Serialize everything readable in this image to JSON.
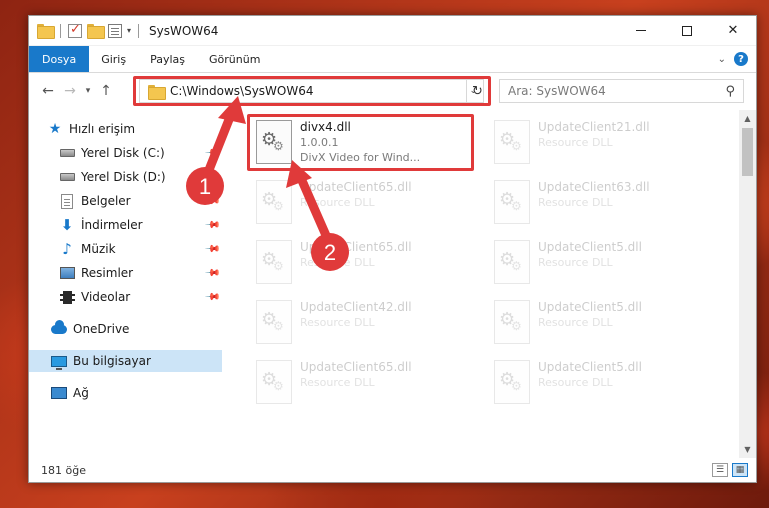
{
  "window": {
    "title": "SysWOW64"
  },
  "ribbon": {
    "tabs": [
      "Dosya",
      "Giriş",
      "Paylaş",
      "Görünüm"
    ]
  },
  "nav": {
    "address": "C:\\Windows\\SysWOW64",
    "search_placeholder": "Ara: SysWOW64"
  },
  "sidebar": {
    "items": [
      {
        "label": "Hızlı erişim",
        "icon": "star-icon"
      },
      {
        "label": "Yerel Disk (C:)",
        "icon": "disk-icon"
      },
      {
        "label": "Yerel Disk (D:)",
        "icon": "disk-icon"
      },
      {
        "label": "Belgeler",
        "icon": "documents-icon"
      },
      {
        "label": "İndirmeler",
        "icon": "downloads-icon"
      },
      {
        "label": "Müzik",
        "icon": "music-icon"
      },
      {
        "label": "Resimler",
        "icon": "pictures-icon"
      },
      {
        "label": "Videolar",
        "icon": "videos-icon"
      },
      {
        "label": "OneDrive",
        "icon": "cloud-icon"
      },
      {
        "label": "Bu bilgisayar",
        "icon": "computer-icon"
      },
      {
        "label": "Ağ",
        "icon": "network-icon"
      }
    ]
  },
  "files": [
    {
      "name": "divx4.dll",
      "line2": "1.0.0.1",
      "line3": "DivX Video for Wind..."
    },
    {
      "name": "UpdateClient21.dll",
      "line2": "Resource DLL"
    },
    {
      "name": "UpdateClient65.dll",
      "line2": "Resource DLL"
    },
    {
      "name": "UpdateClient63.dll",
      "line2": "Resource DLL"
    },
    {
      "name": "UpdateClient65.dll",
      "line2": "Resource DLL"
    },
    {
      "name": "UpdateClient5.dll",
      "line2": "Resource DLL"
    },
    {
      "name": "UpdateClient42.dll",
      "line2": "Resource DLL"
    },
    {
      "name": "UpdateClient5.dll",
      "line2": "Resource DLL"
    },
    {
      "name": "UpdateClient65.dll",
      "line2": "Resource DLL"
    },
    {
      "name": "UpdateClient5.dll",
      "line2": "Resource DLL"
    }
  ],
  "status": {
    "count": "181 öğe"
  },
  "annotations": {
    "step1": "1",
    "step2": "2",
    "highlight_color": "#e03a3a"
  }
}
